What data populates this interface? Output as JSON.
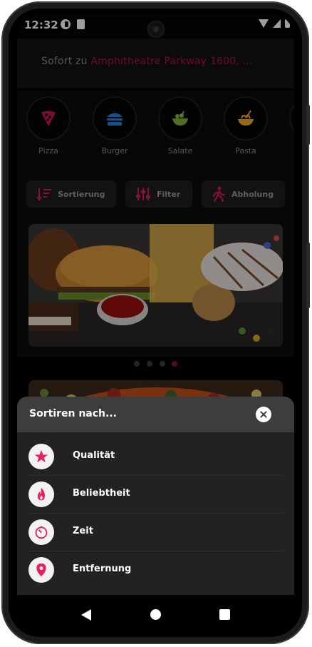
{
  "status": {
    "time": "12:32"
  },
  "header": {
    "prefix": "Sofort zu",
    "address": "Amphitheatre Parkway 1600, ..."
  },
  "categories": [
    {
      "label": "Pizza",
      "icon": "pizza-icon",
      "color": "#c2185b"
    },
    {
      "label": "Burger",
      "icon": "burger-icon",
      "color": "#1e88e5"
    },
    {
      "label": "Salate",
      "icon": "salad-icon",
      "color": "#7cb342"
    },
    {
      "label": "Pasta",
      "icon": "pasta-icon",
      "color": "#f9a825"
    }
  ],
  "chips": [
    {
      "label": "Sortierung",
      "icon": "sort-icon"
    },
    {
      "label": "Filter",
      "icon": "filter-icon"
    },
    {
      "label": "Abholung",
      "icon": "walking-icon"
    }
  ],
  "carousel": {
    "total": 4,
    "active_index": 3
  },
  "sheet": {
    "title": "Sortiren nach...",
    "options": [
      {
        "label": "Qualität",
        "icon": "star-icon"
      },
      {
        "label": "Beliebtheit",
        "icon": "flame-icon"
      },
      {
        "label": "Zeit",
        "icon": "timer-icon"
      },
      {
        "label": "Entfernung",
        "icon": "location-pin-icon"
      }
    ]
  },
  "colors": {
    "accent": "#e91e63",
    "address_highlight": "#b5123c"
  }
}
